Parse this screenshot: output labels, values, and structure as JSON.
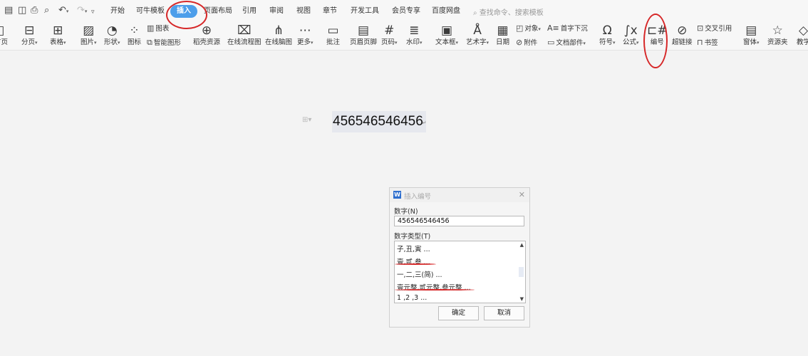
{
  "quick_access": [
    "save-icon",
    "save-as-icon",
    "print-icon",
    "print-preview-icon",
    "undo-icon",
    "redo-icon",
    "customize-icon"
  ],
  "menu": {
    "tabs": [
      "开始",
      "可牛模板",
      "插入",
      "页面布局",
      "引用",
      "审阅",
      "视图",
      "章节",
      "开发工具",
      "会员专享",
      "百度网盘"
    ],
    "active_tab": "插入",
    "search_text": "查找命令、搜索模板"
  },
  "ribbon": {
    "first_page": "首页",
    "page_break": "分页",
    "table": "表格",
    "picture": "图片",
    "shape": "形状",
    "icon": "图标",
    "chart": "图表",
    "smart_art": "智能图形",
    "docer_resource": "稻壳资源",
    "online_flowchart": "在线流程图",
    "online_mindmap": "在线脑图",
    "more": "更多",
    "comment": "批注",
    "header_footer": "页眉页脚",
    "page_number": "页码",
    "watermark": "水印",
    "textbox": "文本框",
    "wordart": "艺术字",
    "date": "日期",
    "object": "对象",
    "attachment": "附件",
    "drop_cap": "首字下沉",
    "doc_parts": "文档部件",
    "symbol": "符号",
    "formula": "公式",
    "numbering": "编号",
    "hyperlink": "超链接",
    "cross_reference": "交叉引用",
    "bookmark": "书签",
    "form": "窗体",
    "resource_folder": "资源夹",
    "teaching": "教学"
  },
  "document": {
    "text": "456546546456"
  },
  "dialog": {
    "title": "插入编号",
    "number_label": "数字(N)",
    "number_value": "456546546456",
    "type_label": "数字类型(T)",
    "types": [
      "子,丑,寅 ...",
      "壹,贰,叁 ...",
      "一,二,三(简) ...",
      "壹元整,贰元整,叁元整 ...",
      "1 ,2 ,3 ..."
    ],
    "ok": "确定",
    "cancel": "取消"
  },
  "annotation_color": "#d62728",
  "accent_color": "#4d9eea"
}
